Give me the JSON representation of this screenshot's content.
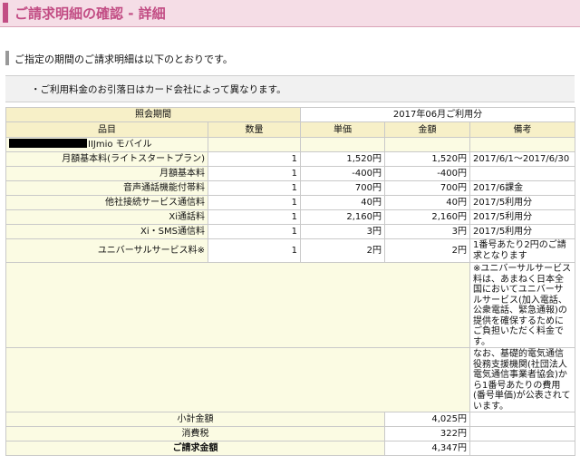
{
  "title": "ご請求明細の確認 - 詳細",
  "lead": "ご指定の期間のご請求明細は以下のとおりです。",
  "notice": "・ご利用料金のお引落日はカード会社によって異なります。",
  "period": {
    "label": "照会期間",
    "value": "2017年06月ご利用分"
  },
  "headers": {
    "item": "品目",
    "qty": "数量",
    "unit": "単価",
    "amount": "金額",
    "remarks": "備考"
  },
  "plan_name": "IIJmio モバイル",
  "rows": [
    {
      "item": "月額基本料(ライトスタートプラン)",
      "qty": "1",
      "unit": "1,520円",
      "amount": "1,520円",
      "remarks": "2017/6/1～2017/6/30"
    },
    {
      "item": "月額基本料",
      "qty": "1",
      "unit": "-400円",
      "amount": "-400円",
      "remarks": ""
    },
    {
      "item": "音声通話機能付帯料",
      "qty": "1",
      "unit": "700円",
      "amount": "700円",
      "remarks": "2017/6課金"
    },
    {
      "item": "他社接続サービス通信料",
      "qty": "1",
      "unit": "40円",
      "amount": "40円",
      "remarks": "2017/5利用分"
    },
    {
      "item": "Xi通話料",
      "qty": "1",
      "unit": "2,160円",
      "amount": "2,160円",
      "remarks": "2017/5利用分"
    },
    {
      "item": "Xi・SMS通信料",
      "qty": "1",
      "unit": "3円",
      "amount": "3円",
      "remarks": "2017/5利用分"
    },
    {
      "item": "ユニバーサルサービス料※",
      "qty": "1",
      "unit": "2円",
      "amount": "2円",
      "remarks": "1番号あたり2円のご請求となります"
    }
  ],
  "note1": "※ユニバーサルサービス料は、あまねく日本全国においてユニバーサルサービス(加入電話、公衆電話、緊急通報)の提供を確保するためにご負担いただく料金です。",
  "note2": "なお、基礎的電気通信役務支援機関(社団法人電気通信事業者協会)から1番号あたりの費用(番号単価)が公表されています。",
  "totals": {
    "subtotal_label": "小計金額",
    "subtotal": "4,025円",
    "tax_label": "消費税",
    "tax": "322円",
    "total_label": "ご請求金額",
    "total": "4,347円"
  }
}
